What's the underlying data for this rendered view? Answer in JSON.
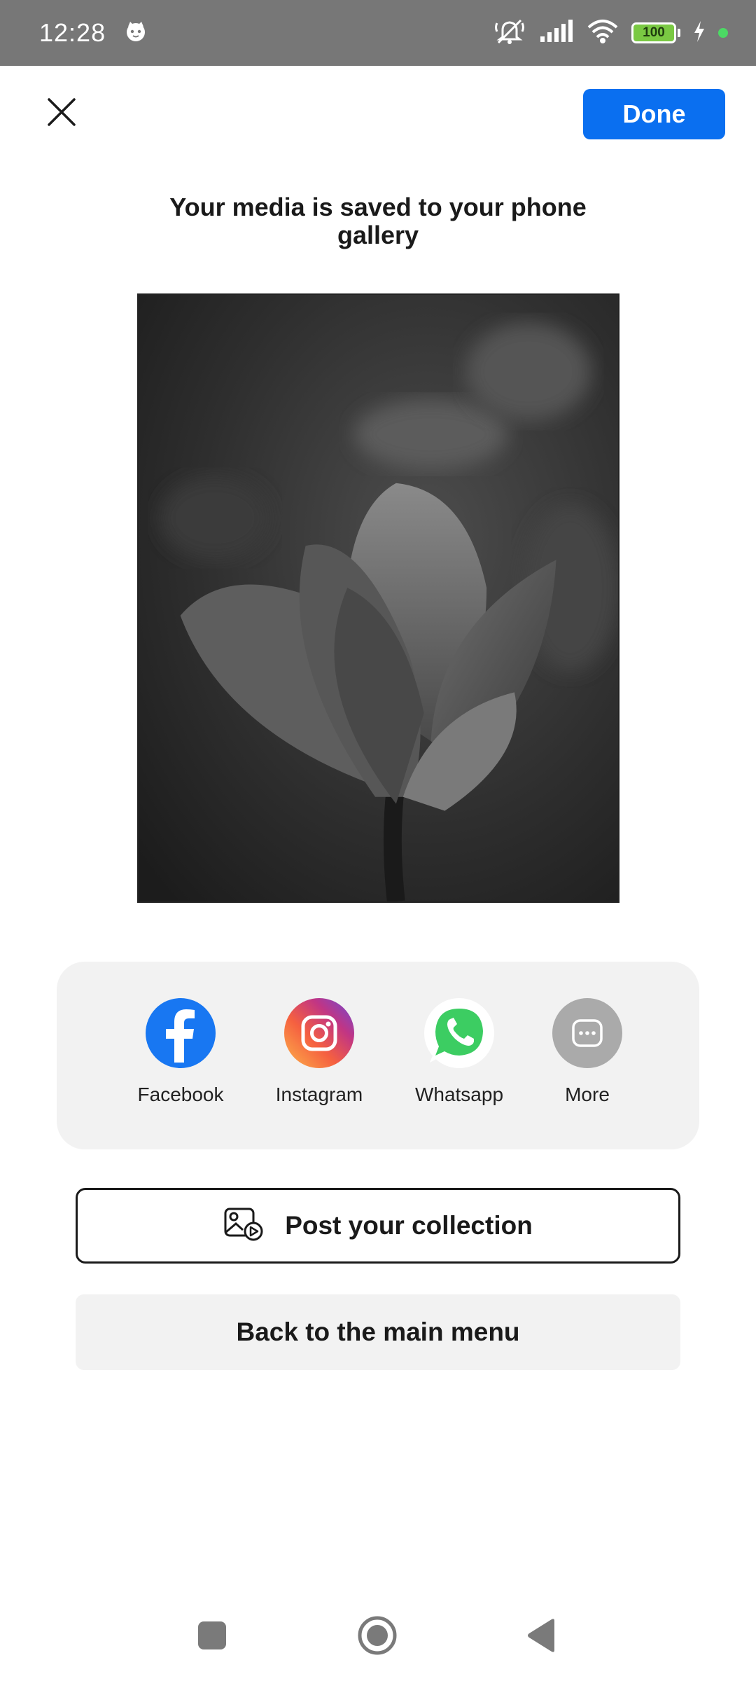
{
  "status_bar": {
    "time": "12:28",
    "battery_level": "100",
    "icons": [
      "cat-notification-icon",
      "muted-icon",
      "signal-icon",
      "wifi-icon",
      "battery-icon",
      "charging-icon"
    ]
  },
  "header": {
    "close_icon": "close-icon",
    "done_label": "Done"
  },
  "main": {
    "headline": "Your media is saved to your phone gallery"
  },
  "share": {
    "items": [
      {
        "label": "Facebook",
        "icon": "facebook-icon",
        "color": "#1877f2"
      },
      {
        "label": "Instagram",
        "icon": "instagram-icon",
        "color": "#e1306c"
      },
      {
        "label": "Whatsapp",
        "icon": "whatsapp-icon",
        "color": "#25d366"
      },
      {
        "label": "More",
        "icon": "more-icon",
        "color": "#aaaaaa"
      }
    ]
  },
  "actions": {
    "post_label": "Post your collection",
    "back_label": "Back to the main menu"
  },
  "colors": {
    "accent": "#0a6ff0",
    "status_bar": "#777777",
    "card_bg": "#f2f2f2"
  },
  "nav": {
    "items": [
      "recents-icon",
      "home-icon",
      "back-icon"
    ]
  }
}
